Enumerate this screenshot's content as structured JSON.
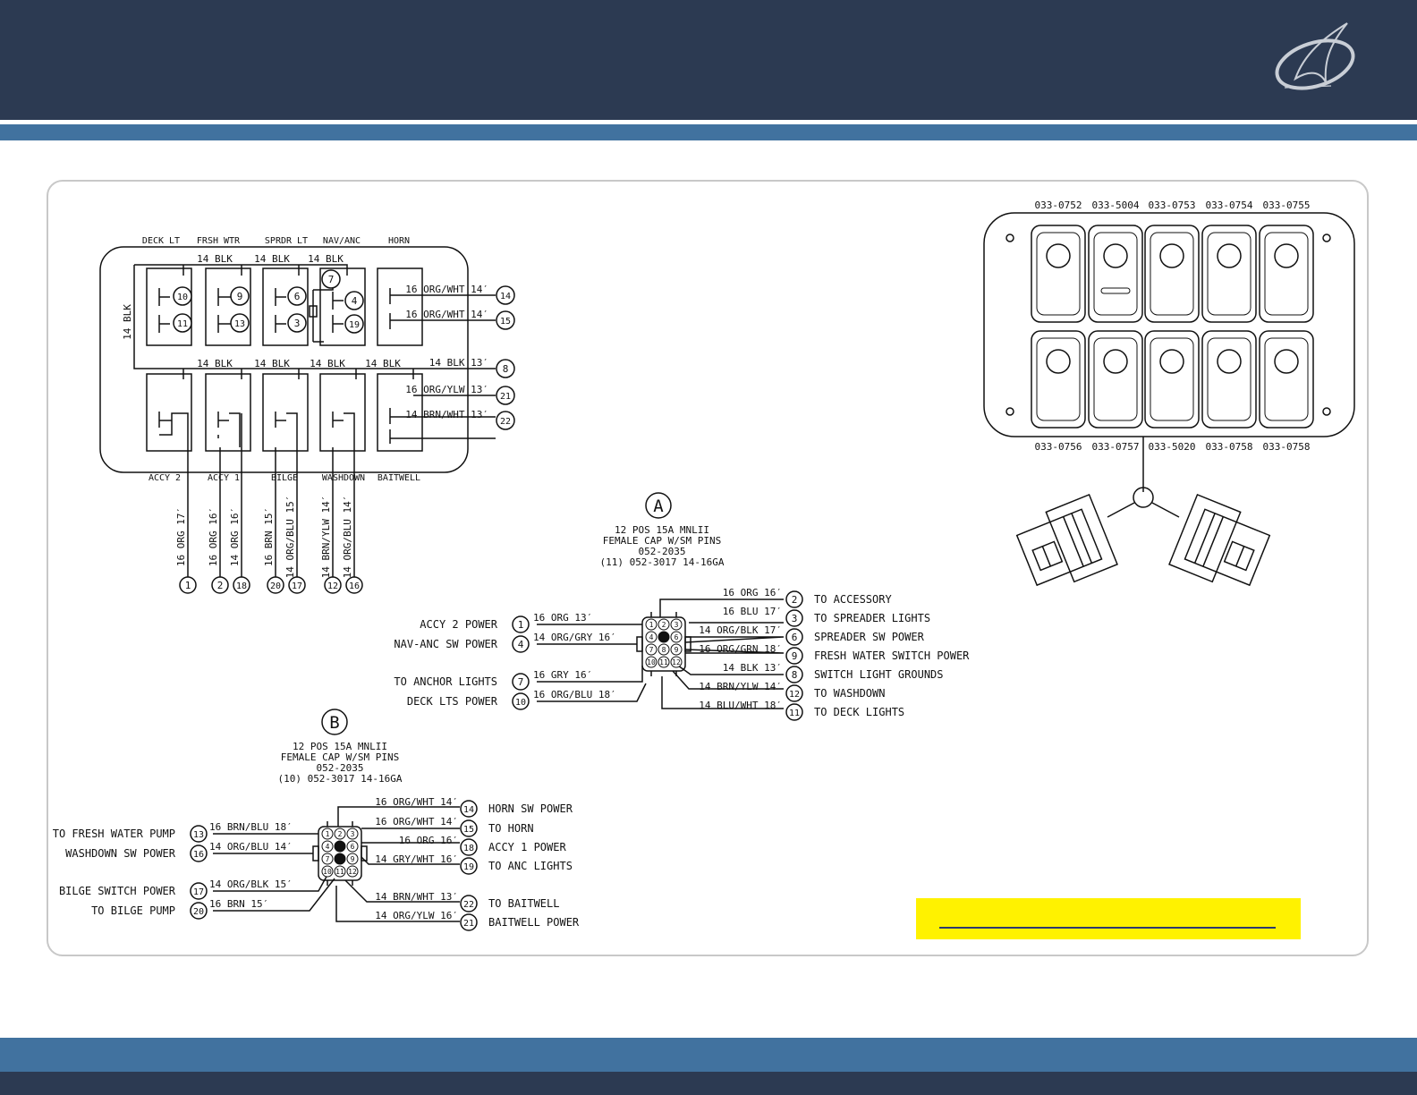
{
  "brand": {
    "header_color": "#2c3a52",
    "stripe_color": "#41729f",
    "highlight_color": "#fff200"
  },
  "relay_panel": {
    "top_labels": [
      "DECK LT",
      "FRSH WTR",
      "SPRDR LT",
      "NAV/ANC",
      "HORN"
    ],
    "bottom_labels": [
      "ACCY 2",
      "ACCY 1",
      "BILGE",
      "WASHDOWN",
      "BAITWELL"
    ],
    "side_label": "14 BLK",
    "top_bus_labels": [
      "14 BLK",
      "14 BLK",
      "14 BLK"
    ],
    "mid_bus_labels": [
      "14 BLK",
      "14 BLK",
      "14 BLK",
      "14 BLK"
    ],
    "relay_pins": [
      "10",
      "11",
      "9",
      "13",
      "6",
      "3",
      "7",
      "4",
      "19"
    ],
    "right_wires": [
      {
        "label": "16 ORG/WHT 14′",
        "pin": "14"
      },
      {
        "label": "16 ORG/WHT 14′",
        "pin": "15"
      },
      {
        "label": "14 BLK 13′",
        "pin": "8"
      },
      {
        "label": "16 ORG/YLW 13′",
        "pin": "21"
      },
      {
        "label": "14 BRN/WHT 13′",
        "pin": "22"
      }
    ],
    "down_wires": [
      {
        "label": "16 ORG 17′",
        "pin": "1"
      },
      {
        "label": "16 ORG 16′",
        "pin": "2"
      },
      {
        "label": "14 ORG 16′",
        "pin": "18"
      },
      {
        "label": "16 BRN 15′",
        "pin": "20"
      },
      {
        "label": "14 ORG/BLU 15′",
        "pin": "17"
      },
      {
        "label": "14 BRN/YLW 14′",
        "pin": "12"
      },
      {
        "label": "14 ORG/BLU 14′",
        "pin": "16"
      }
    ]
  },
  "switch_panel": {
    "top_part_numbers": [
      "033-0752",
      "033-5004",
      "033-0753",
      "033-0754",
      "033-0755"
    ],
    "bottom_part_numbers": [
      "033-0756",
      "033-0757",
      "033-5020",
      "033-0758",
      "033-0758"
    ]
  },
  "connector_a": {
    "letter": "A",
    "desc": [
      "12 POS 15A MNLII",
      "FEMALE CAP W/SM PINS",
      "052-2035",
      "(11) 052-3017 14-16GA"
    ],
    "pins": [
      "1",
      "2",
      "3",
      "4",
      "5",
      "6",
      "7",
      "8",
      "9",
      "10",
      "11",
      "12"
    ],
    "left": [
      {
        "name": "ACCY 2 POWER",
        "pin": "1",
        "wire": "16 ORG 13′"
      },
      {
        "name": "NAV-ANC SW POWER",
        "pin": "4",
        "wire": "14 ORG/GRY 16′"
      },
      {
        "name": "TO ANCHOR LIGHTS",
        "pin": "7",
        "wire": "16 GRY 16′"
      },
      {
        "name": "DECK LTS POWER",
        "pin": "10",
        "wire": "16 ORG/BLU 18′"
      }
    ],
    "right": [
      {
        "wire": "16 ORG 16′",
        "pin": "2",
        "name": "TO ACCESSORY"
      },
      {
        "wire": "16 BLU 17′",
        "pin": "3",
        "name": "TO SPREADER LIGHTS"
      },
      {
        "wire": "14 ORG/BLK 17′",
        "pin": "6",
        "name": "SPREADER SW POWER"
      },
      {
        "wire": "16 ORG/GRN 18′",
        "pin": "9",
        "name": "FRESH WATER SWITCH POWER"
      },
      {
        "wire": "14 BLK 13′",
        "pin": "8",
        "name": "SWITCH LIGHT GROUNDS"
      },
      {
        "wire": "14 BRN/YLW 14′",
        "pin": "12",
        "name": "TO WASHDOWN"
      },
      {
        "wire": "14 BLU/WHT 18′",
        "pin": "11",
        "name": "TO DECK LIGHTS"
      }
    ]
  },
  "connector_b": {
    "letter": "B",
    "desc": [
      "12 POS 15A MNLII",
      "FEMALE CAP W/SM PINS",
      "052-2035",
      "(10) 052-3017 14-16GA"
    ],
    "pins": [
      "1",
      "2",
      "3",
      "4",
      "5",
      "6",
      "7",
      "8",
      "9",
      "10",
      "11",
      "12"
    ],
    "left": [
      {
        "name": "TO FRESH WATER PUMP",
        "pin": "13",
        "wire": "16 BRN/BLU 18′"
      },
      {
        "name": "WASHDOWN SW POWER",
        "pin": "16",
        "wire": "14 ORG/BLU 14′"
      },
      {
        "name": "BILGE SWITCH POWER",
        "pin": "17",
        "wire": "14 ORG/BLK 15′"
      },
      {
        "name": "TO BILGE PUMP",
        "pin": "20",
        "wire": "16 BRN 15′"
      }
    ],
    "right": [
      {
        "wire": "16 ORG/WHT 14′",
        "pin": "14",
        "name": "HORN SW POWER"
      },
      {
        "wire": "16 ORG/WHT 14′",
        "pin": "15",
        "name": "TO HORN"
      },
      {
        "wire": "16 ORG 16′",
        "pin": "18",
        "name": "ACCY 1 POWER"
      },
      {
        "wire": "14 GRY/WHT 16′",
        "pin": "19",
        "name": "TO ANC LIGHTS"
      },
      {
        "wire": "14 BRN/WHT 13′",
        "pin": "22",
        "name": "TO BAITWELL"
      },
      {
        "wire": "14 ORG/YLW 16′",
        "pin": "21",
        "name": "BAITWELL POWER"
      }
    ]
  }
}
